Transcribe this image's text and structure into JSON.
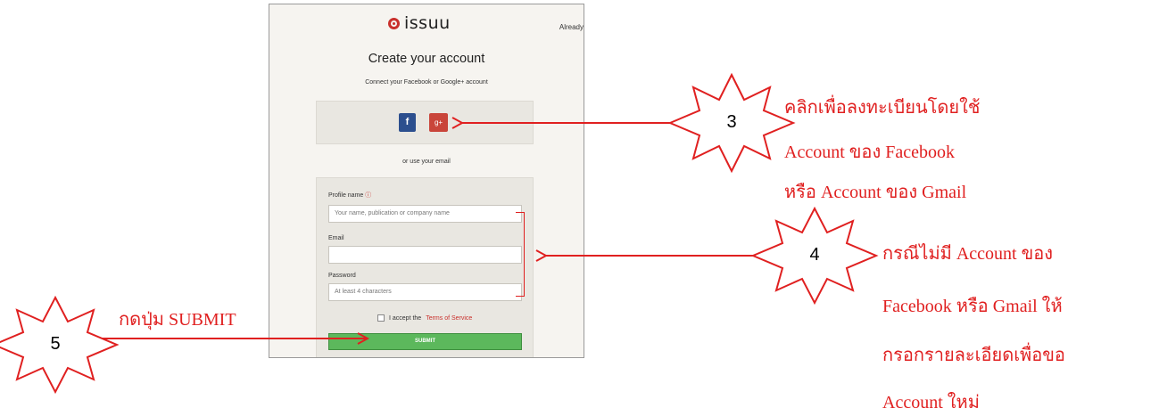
{
  "site": {
    "logo_text": "issuu",
    "already_text": "Already"
  },
  "signup": {
    "title": "Create your account",
    "connect_subtitle": "Connect your Facebook or Google+ account",
    "facebook_label": "f",
    "google_label": "g+",
    "or_email": "or use your email"
  },
  "form": {
    "profile_label": "Profile name",
    "profile_info_icon": "info-icon",
    "profile_placeholder": "Your name, publication or company name",
    "email_label": "Email",
    "email_value": "",
    "password_label": "Password",
    "password_placeholder": "At least 4 characters",
    "accept_text": "I accept the",
    "terms_link": "Terms of Service",
    "submit_label": "SUBMIT"
  },
  "annotations": {
    "step3": {
      "number": "3",
      "lines": [
        "คลิกเพื่อลงทะเบียนโดยใช้",
        "Account ของ Facebook",
        "หรือ Account ของ Gmail"
      ]
    },
    "step4": {
      "number": "4",
      "lines": [
        "กรณีไม่มี Account ของ",
        "Facebook หรือ  Gmail ให้",
        "กรอกรายละเอียดเพื่อขอ",
        "Account ใหม่"
      ]
    },
    "step5": {
      "number": "5",
      "text": "กดปุ่ม SUBMIT"
    }
  },
  "colors": {
    "annotation_red": "#e02020",
    "issuu_red": "#c9302c",
    "facebook_blue": "#2c4f8e",
    "google_red": "#c9453a",
    "submit_green": "#5cb85c"
  }
}
